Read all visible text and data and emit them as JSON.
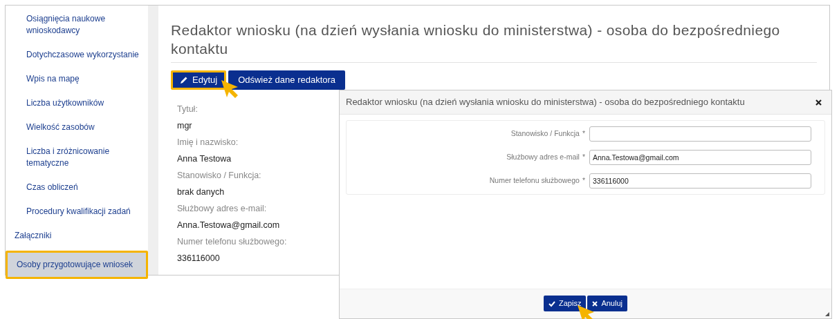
{
  "sidebar": {
    "items": [
      {
        "label": "Osiągnięcia naukowe wnioskodawcy",
        "kind": "subitem",
        "selected": false
      },
      {
        "label": "Dotychczasowe wykorzystanie",
        "kind": "subitem",
        "selected": false
      },
      {
        "label": "Wpis na mapę",
        "kind": "subitem",
        "selected": false
      },
      {
        "label": "Liczba użytkowników",
        "kind": "subitem",
        "selected": false
      },
      {
        "label": "Wielkość zasobów",
        "kind": "subitem",
        "selected": false
      },
      {
        "label": "Liczba i zróżnicowanie tematyczne",
        "kind": "subitem",
        "selected": false
      },
      {
        "label": "Czas obliczeń",
        "kind": "subitem",
        "selected": false
      },
      {
        "label": "Procedury kwalifikacji zadań",
        "kind": "subitem",
        "selected": false
      },
      {
        "label": "Załączniki",
        "kind": "item",
        "selected": false
      },
      {
        "label": "Osoby przygotowujące wniosek",
        "kind": "item",
        "selected": true
      }
    ]
  },
  "section": {
    "title": "Redaktor wniosku (na dzień wysłania wniosku do ministerstwa) - osoba do bezpośredniego kontaktu",
    "buttons": [
      {
        "label": "Edytuj",
        "kind": "edit",
        "highlighted": true
      },
      {
        "label": "Odśwież dane redaktora",
        "kind": "plain",
        "highlighted": false
      }
    ],
    "fields": [
      {
        "label": "Tytuł:",
        "value": "mgr"
      },
      {
        "label": "Imię i nazwisko:",
        "value": "Anna Testowa"
      },
      {
        "label": "Stanowisko / Funkcja:",
        "value": "brak danych"
      },
      {
        "label": "Służbowy adres e-mail:",
        "value": "Anna.Testowa@gmail.com"
      },
      {
        "label": "Numer telefonu służbowego:",
        "value": "336116000"
      }
    ]
  },
  "dialog": {
    "title": "Redaktor wniosku (na dzień wysłania wniosku do ministerstwa) - osoba do bezpośredniego kontaktu",
    "fields": [
      {
        "label": "Stanowisko / Funkcja",
        "required_mark": "*"
      },
      {
        "label": "Służbowy adres e-mail",
        "required_mark": "*",
        "value": "Anna.Testowa@gmail.com"
      },
      {
        "label": "Numer telefonu służbowego",
        "required_mark": "*",
        "value": "336116000"
      }
    ],
    "buttons": [
      {
        "label": "Zapisz",
        "kind": "save"
      },
      {
        "label": "Anuluj",
        "kind": "cancel"
      }
    ]
  }
}
